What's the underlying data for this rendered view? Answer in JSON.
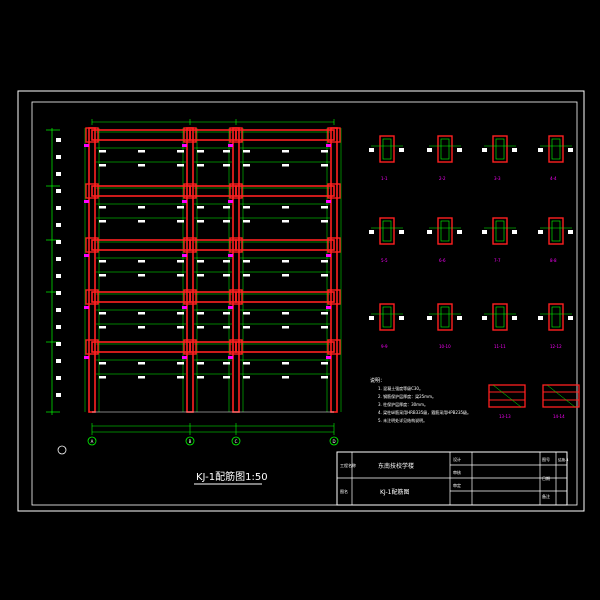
{
  "drawing": {
    "title": "KJ-1配筋图1:50",
    "notes_heading": "说明：",
    "notes": [
      "1. 混凝土强度等级C30。",
      "2. 钢筋保护层厚度：梁25mm。",
      "3. 柱保护层厚度：30mm。",
      "4. 梁柱纵筋采用HRB335级，箍筋采用HPB235级。",
      "5. 未注明处详见结构说明。"
    ],
    "section_labels": [
      "1-1",
      "2-2",
      "3-3",
      "4-4",
      "5-5",
      "6-6",
      "7-7",
      "8-8",
      "9-9",
      "10-10",
      "11-11",
      "12-12",
      "13-13",
      "14-14"
    ],
    "axis_bubbles": [
      "A",
      "B",
      "C",
      "D"
    ]
  },
  "title_block": {
    "project_label": "工程名称",
    "drawing_label": "图名",
    "project_name": "东南技校学楼",
    "drawing_name": "KJ-1配筋图",
    "designer_label": "设计",
    "checker_label": "审核",
    "approver_label": "审定",
    "scale_label": "图号",
    "sheet_label": "日期",
    "remark_label": "备注",
    "drawing_no": "结施-4"
  },
  "colors": {
    "background": "#000000",
    "frame": "#ffffff",
    "beam": "#ff2020",
    "rebar": "#00ff00",
    "dim": "#00ffff",
    "label": "#ff00ff",
    "text": "#ffffff"
  }
}
